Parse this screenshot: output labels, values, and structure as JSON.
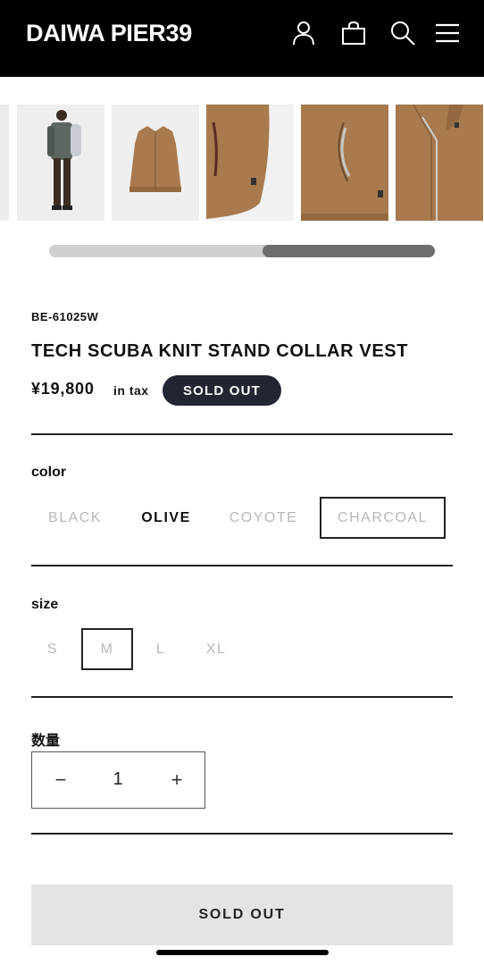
{
  "header": {
    "logo": "DAIWA PIER39",
    "icons": [
      "account-icon",
      "cart-icon",
      "search-icon",
      "menu-icon"
    ]
  },
  "gallery": {
    "thumbnails": [
      "model-wearing-vest",
      "vest-front",
      "vest-hem-detail",
      "vest-pocket-detail",
      "vest-collar-detail"
    ]
  },
  "product": {
    "sku": "BE-61025W",
    "name": "TECH SCUBA KNIT STAND COLLAR VEST",
    "price": "¥19,800",
    "tax_label": "in tax",
    "status_badge": "SOLD OUT"
  },
  "color": {
    "label": "color",
    "options": [
      "BLACK",
      "OLIVE",
      "COYOTE",
      "CHARCOAL"
    ],
    "highlighted": "OLIVE",
    "selected": "CHARCOAL"
  },
  "size": {
    "label": "size",
    "options": [
      "S",
      "M",
      "L",
      "XL"
    ],
    "selected": "M"
  },
  "quantity": {
    "label": "数量",
    "minus": "−",
    "value": "1",
    "plus": "+"
  },
  "cta": {
    "label": "SOLD OUT"
  },
  "colors": {
    "header_bg": "#000000",
    "badge_bg": "#222633",
    "fabric": "#a87a4e",
    "disabled_text": "#b8b8b8",
    "button_bg": "#e4e4e4"
  }
}
